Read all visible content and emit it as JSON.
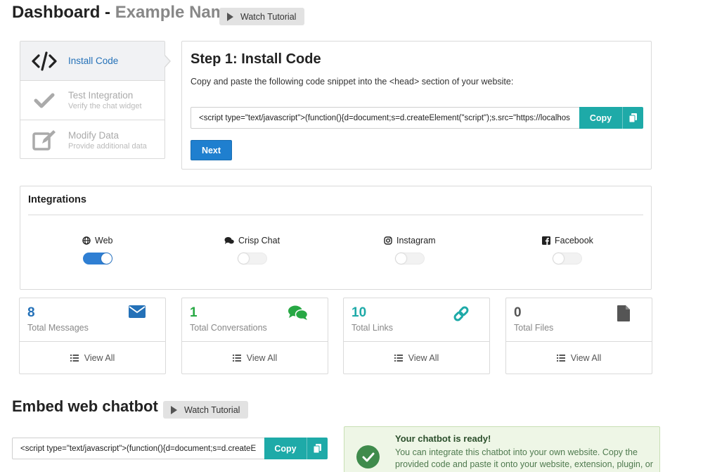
{
  "header": {
    "title": "Dashboard -",
    "subtitle": "Example Name",
    "tutorial_label": "Watch Tutorial"
  },
  "steps": [
    {
      "label": "Install Code",
      "sub": "",
      "icon": "code-icon",
      "active": true
    },
    {
      "label": "Test Integration",
      "sub": "Verify the chat widget",
      "icon": "checkmark-icon",
      "active": false
    },
    {
      "label": "Modify Data",
      "sub": "Provide additional data",
      "icon": "edit-icon",
      "active": false
    }
  ],
  "install": {
    "title": "Step 1: Install Code",
    "description": "Copy and paste the following code snippet into the <head> section of your website:",
    "code": "<script type=\"text/javascript\">(function(){d=document;s=d.createElement(\"script\");s.src=\"https://localhos",
    "copy_label": "Copy",
    "next_label": "Next"
  },
  "integrations": {
    "title": "Integrations",
    "items": [
      {
        "label": "Web",
        "icon": "globe-icon",
        "enabled": true
      },
      {
        "label": "Crisp Chat",
        "icon": "chat-bubbles-icon",
        "enabled": false
      },
      {
        "label": "Instagram",
        "icon": "instagram-icon",
        "enabled": false
      },
      {
        "label": "Facebook",
        "icon": "facebook-icon",
        "enabled": false
      }
    ]
  },
  "stats": [
    {
      "value": "8",
      "label": "Total Messages",
      "icon": "envelope-icon",
      "color": "#2471b8",
      "view": "View All"
    },
    {
      "value": "1",
      "label": "Total Conversations",
      "icon": "comments-icon",
      "color": "#27a844",
      "view": "View All"
    },
    {
      "value": "10",
      "label": "Total Links",
      "icon": "link-icon",
      "color": "#1eaaa8",
      "view": "View All"
    },
    {
      "value": "0",
      "label": "Total Files",
      "icon": "file-icon",
      "color": "#555555",
      "view": "View All"
    }
  ],
  "embed": {
    "title": "Embed web chatbot",
    "tutorial_label": "Watch Tutorial",
    "code": "<script type=\"text/javascript\">(function(){d=document;s=d.createE",
    "copy_label": "Copy",
    "ready_title": "Your chatbot is ready!",
    "ready_body": "You can integrate this chatbot into your own website. Copy the provided code and paste it onto your website, extension, plugin, or"
  },
  "colors": {
    "primary": "#1f7fcf",
    "teal": "#1eaaa8",
    "success": "#3f8b4c"
  }
}
